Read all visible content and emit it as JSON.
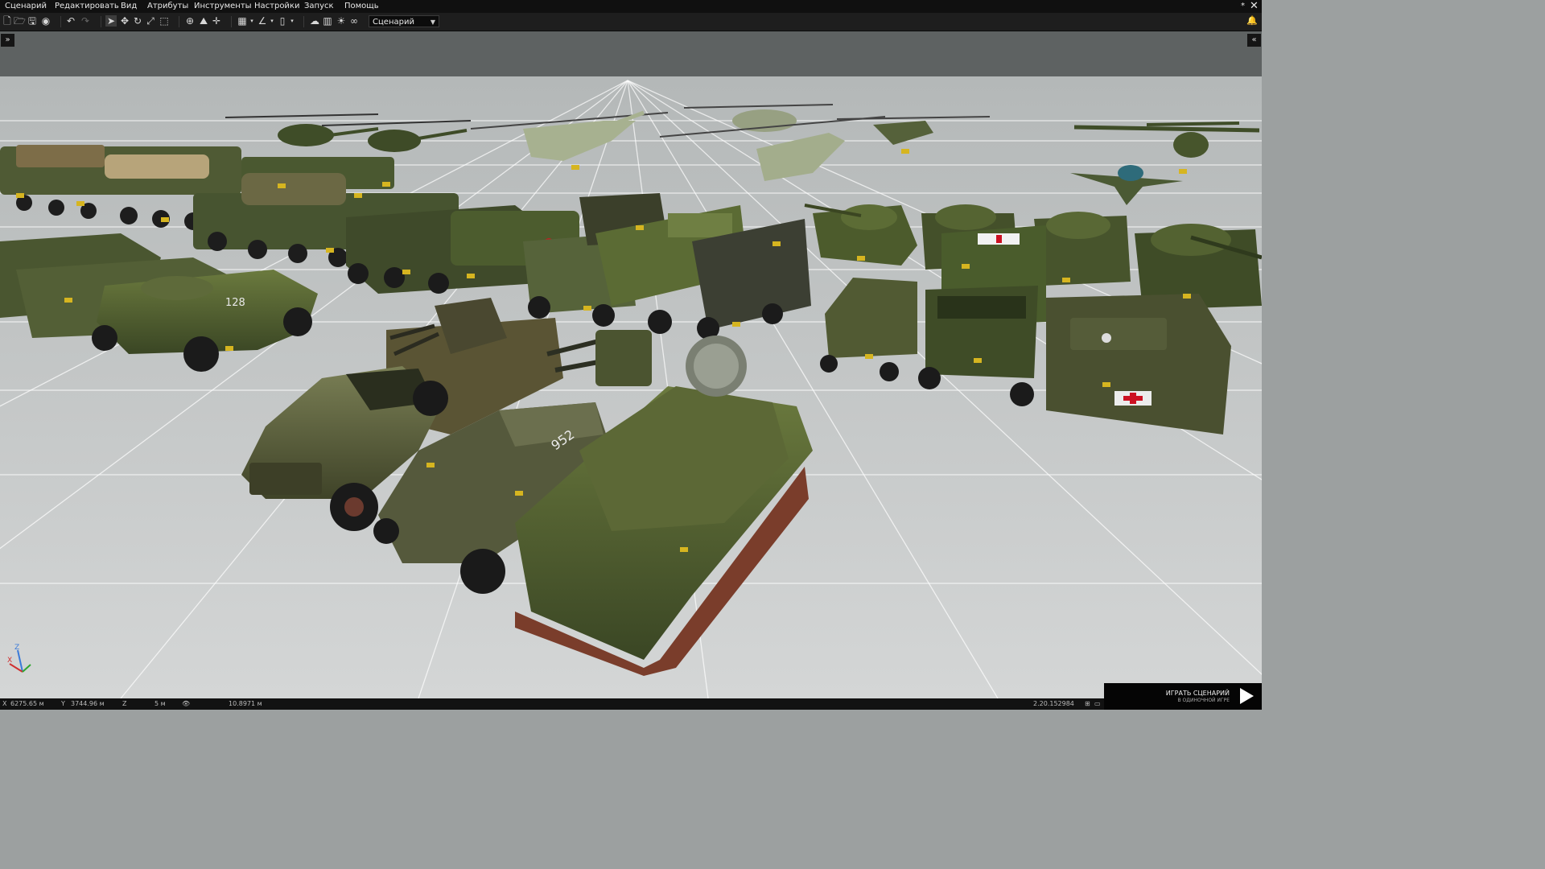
{
  "menu": {
    "items": [
      "Сценарий",
      "Редактировать",
      "Вид",
      "Атрибуты",
      "Инструменты",
      "Настройки",
      "Запуск",
      "Помощь"
    ],
    "asterisk": "*"
  },
  "toolbar": {
    "mode_select_value": "Сценарий",
    "icons": [
      "new-file-icon",
      "open-folder-icon",
      "save-icon",
      "save-as-icon",
      "steam-publish-icon",
      "undo-icon",
      "redo-icon",
      "select-cursor-icon",
      "move-icon",
      "rotate-icon",
      "scale-icon",
      "transform-box-icon",
      "globe-icon",
      "terrain-snap-icon",
      "vertical-mode-icon",
      "grid-icon",
      "angle-snap-icon",
      "ruler-icon",
      "weather-icon",
      "intel-icon",
      "lighting-icon",
      "camera-view-icon"
    ]
  },
  "panels": {
    "left_expand": "»",
    "right_expand": "«"
  },
  "scene": {
    "vehicles": [
      {
        "name": "mi2-helicopter-left",
        "type": "helicopter"
      },
      {
        "name": "mi2-helicopter-right",
        "type": "helicopter"
      },
      {
        "name": "mi8-helicopter-camo",
        "type": "helicopter"
      },
      {
        "name": "mi8-helicopter-back",
        "type": "helicopter"
      },
      {
        "name": "mi8-helicopter-front",
        "type": "helicopter"
      },
      {
        "name": "mi24-helicopter",
        "type": "helicopter"
      },
      {
        "name": "an2-biplane",
        "type": "plane"
      },
      {
        "name": "su-jet",
        "type": "plane"
      },
      {
        "name": "btr-apc-128",
        "type": "apc",
        "label": "128"
      },
      {
        "name": "btr152-apc-952",
        "type": "apc",
        "label": "952"
      },
      {
        "name": "zil157-aa-truck",
        "type": "truck"
      },
      {
        "name": "zsu23-shilka",
        "type": "spaa"
      },
      {
        "name": "t55-tank-row",
        "type": "tank"
      },
      {
        "name": "ural-trucks",
        "type": "truck"
      },
      {
        "name": "ambulance-truck",
        "type": "truck"
      },
      {
        "name": "mtlb-ambulance",
        "type": "apc"
      },
      {
        "name": "brdm-scout",
        "type": "car"
      }
    ]
  },
  "status": {
    "x_label": "X",
    "x_value": "6275.65 м",
    "y_label": "Y",
    "y_value": "3744.96 м",
    "z_label": "Z",
    "z_value": "5 м",
    "view_value": "10.8971 м",
    "version": "2.20.152984"
  },
  "play": {
    "label": "ИГРАТЬ СЦЕНАРИЙ",
    "sublabel": "В ОДИНОЧНОЙ ИГРЕ"
  },
  "colors": {
    "menubar": "#101010",
    "toolbar": "#1e1e1e",
    "panel": "#5e6262",
    "ground": "#c9cccc",
    "grid": "#ffffff",
    "vehicle_green": "#4a5a2c",
    "vehicle_dark": "#2f3a1e",
    "tag": "#d6b520"
  }
}
